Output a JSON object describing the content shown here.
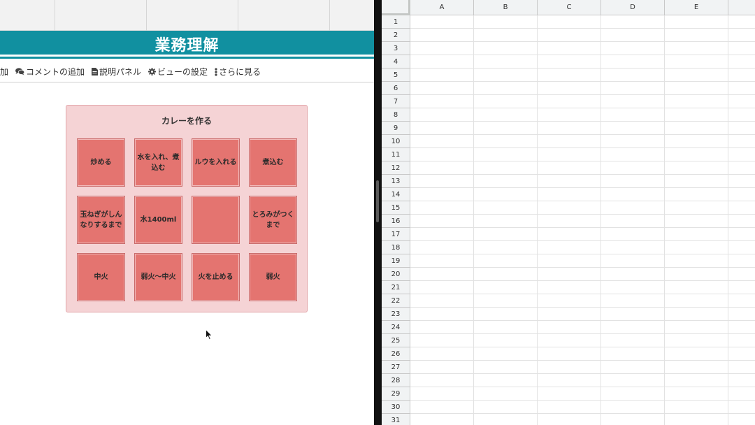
{
  "app": {
    "board_header_title": "業務理解"
  },
  "toolbar": {
    "items": [
      {
        "label": "加",
        "icon": "partial-item"
      },
      {
        "label": "コメントの追加",
        "icon": "comments-icon"
      },
      {
        "label": "説明パネル",
        "icon": "document-icon"
      },
      {
        "label": "ビューの設定",
        "icon": "gear-icon"
      },
      {
        "label": "さらに見る",
        "icon": "vertical-ellipsis-icon"
      }
    ]
  },
  "board": {
    "title": "カレーを作る",
    "cards": [
      "炒める",
      "水を入れ、煮込む",
      "ルウを入れる",
      "煮込む",
      "玉ねぎがしんなりするまで",
      "水1400ml",
      "",
      "とろみがつくまで",
      "中火",
      "弱火〜中火",
      "火を止める",
      "弱火"
    ],
    "colors": {
      "card": "#e47470",
      "board_bg": "#f5d3d5",
      "header": "#1190a0"
    }
  },
  "sheet": {
    "columns": [
      "A",
      "B",
      "C",
      "D",
      "E"
    ],
    "rows": [
      "1",
      "2",
      "3",
      "4",
      "5",
      "6",
      "7",
      "8",
      "9",
      "10",
      "11",
      "12",
      "13",
      "14",
      "15",
      "16",
      "17",
      "18",
      "19",
      "20",
      "21",
      "22",
      "23",
      "24",
      "25",
      "26",
      "27",
      "28",
      "29",
      "30",
      "31"
    ]
  }
}
